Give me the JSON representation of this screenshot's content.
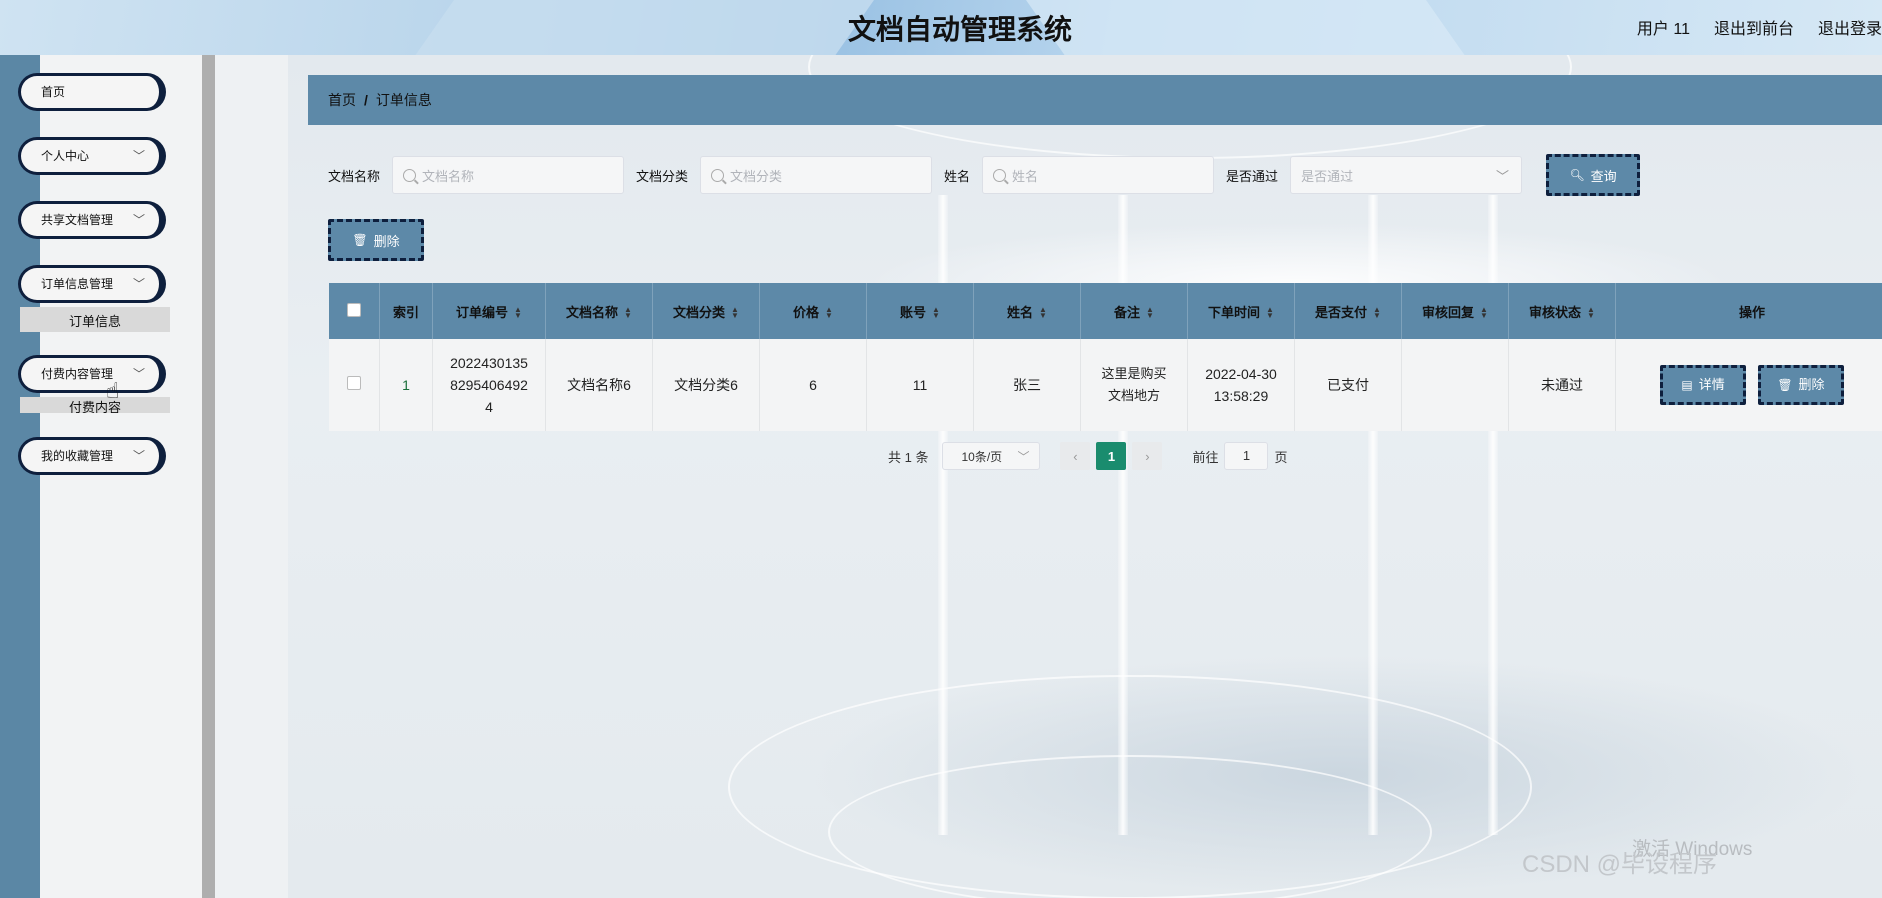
{
  "header": {
    "title": "文档自动管理系统",
    "user": "用户 11",
    "back_front": "退出到前台",
    "logout": "退出登录"
  },
  "sidebar": {
    "items": [
      {
        "label": "首页"
      },
      {
        "label": "个人中心"
      },
      {
        "label": "共享文档管理"
      },
      {
        "label": "订单信息管理"
      },
      {
        "label": "付费内容管理"
      },
      {
        "label": "我的收藏管理"
      }
    ],
    "submenu_order": "订单信息",
    "submenu_paid": "付费内容"
  },
  "breadcrumb": {
    "home": "首页",
    "separator": "/",
    "current": "订单信息"
  },
  "search": {
    "doc_name_label": "文档名称",
    "doc_name_placeholder": "文档名称",
    "doc_category_label": "文档分类",
    "doc_category_placeholder": "文档分类",
    "name_label": "姓名",
    "name_placeholder": "姓名",
    "passed_label": "是否通过",
    "passed_placeholder": "是否通过",
    "query_button": "查询"
  },
  "toolbar": {
    "delete_button": "删除"
  },
  "table": {
    "headers": [
      "索引",
      "订单编号",
      "文档名称",
      "文档分类",
      "价格",
      "账号",
      "姓名",
      "备注",
      "下单时间",
      "是否支付",
      "审核回复",
      "审核状态",
      "操作"
    ],
    "rows": [
      {
        "index": "1",
        "order_no_1": "2022430135",
        "order_no_2": "8295406492",
        "order_no_3": "4",
        "doc_name": "文档名称6",
        "doc_category": "文档分类6",
        "price": "6",
        "account": "11",
        "name": "张三",
        "remark_1": "这里是购买",
        "remark_2": "文档地方",
        "order_date": "2022-04-30",
        "order_time": "13:58:29",
        "paid": "已支付",
        "review_reply": "",
        "review_status": "未通过",
        "detail_button": "详情",
        "delete_button": "删除"
      }
    ]
  },
  "pagination": {
    "total": "共 1 条",
    "page_size": "10条/页",
    "current_page": "1",
    "goto_label": "前往",
    "goto_value": "1",
    "page_suffix": "页"
  },
  "watermark": {
    "windows": "激活 Windows",
    "csdn": "CSDN @毕设程序"
  },
  "colors": {
    "accent": "#5d89a8",
    "dark_border": "#0e1f3d",
    "active_page": "#1a8c6e"
  }
}
